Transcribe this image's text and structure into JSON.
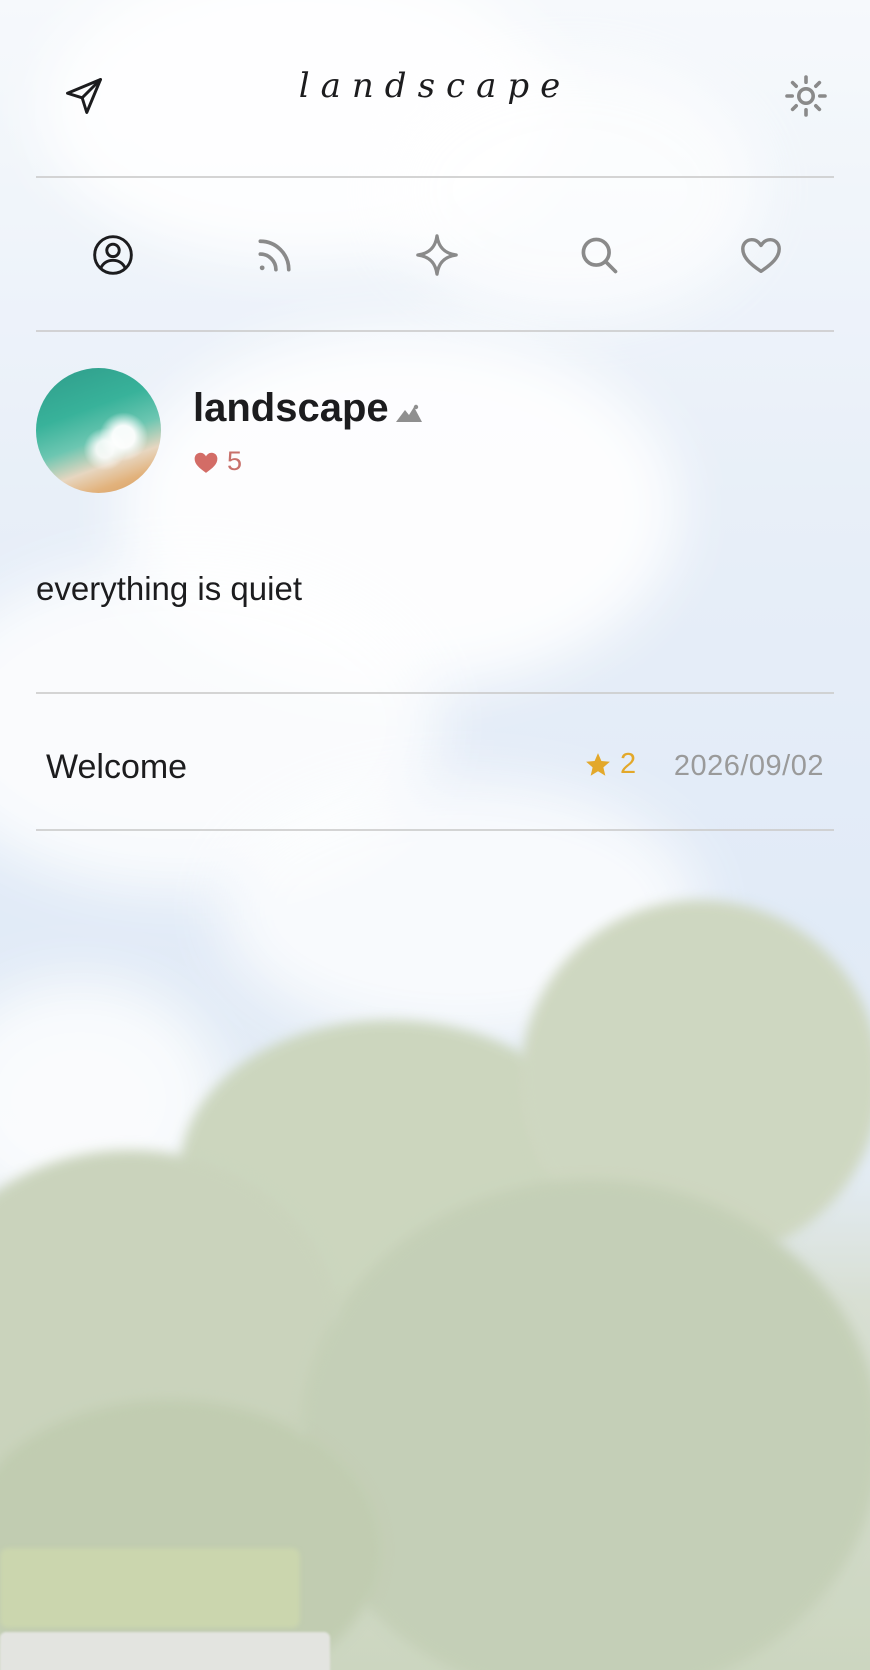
{
  "header": {
    "title": "landscape",
    "left_icon": "navigation-arrow-icon",
    "right_icon": "sun-icon"
  },
  "tabs": [
    {
      "icon": "user-circle-icon",
      "active": true
    },
    {
      "icon": "rss-feed-icon",
      "active": false
    },
    {
      "icon": "sparkle-icon",
      "active": false
    },
    {
      "icon": "search-icon",
      "active": false
    },
    {
      "icon": "heart-icon",
      "active": false
    }
  ],
  "profile": {
    "name": "landscape",
    "badge_icon": "mountain-icon",
    "likes": "5",
    "like_color": "#c8706a"
  },
  "bio": "everything is quiet",
  "posts": [
    {
      "title": "Welcome",
      "stars": "2",
      "date": "2026/09/02",
      "star_color": "#e3a82a"
    }
  ]
}
